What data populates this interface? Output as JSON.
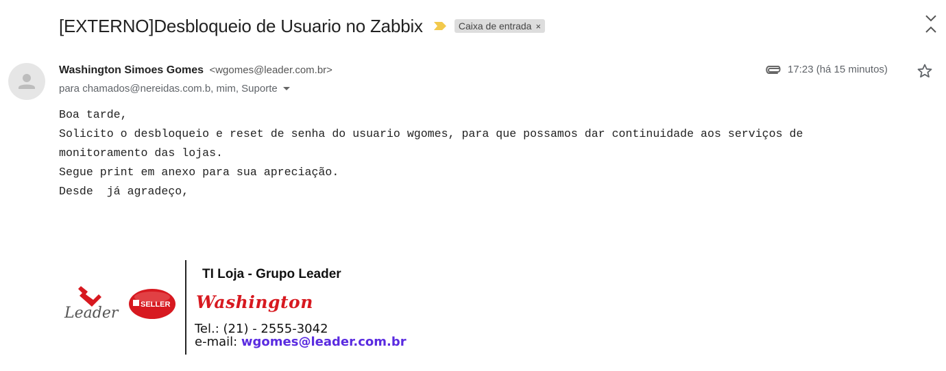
{
  "email": {
    "subject": "[EXTERNO]Desbloqueio de Usuario no Zabbix",
    "label": "Caixa de entrada",
    "label_close": "×",
    "sender_name": "Washington Simoes Gomes",
    "sender_email": "<wgomes@leader.com.br>",
    "recipients": "para chamados@nereidas.com.b, mim, Suporte",
    "time": "17:23 (há 15 minutos)",
    "body_lines": [
      "Boa tarde,",
      "Solicito o desbloqueio e reset de senha do usuario wgomes, para que possamos dar continuidade aos serviços de",
      "monitoramento das lojas.",
      "Segue print em anexo para sua apreciação.",
      "",
      "Desde  já agradeço,"
    ]
  },
  "signature": {
    "title": "TI Loja - Grupo Leader",
    "name": "Washington",
    "tel": "Tel.: (21) - 2555-3042",
    "email_label": "e-mail: ",
    "email_address": "wgomes@leader.com.br",
    "leader_logo_text": "Leader",
    "seller_logo_text": "SELLER"
  },
  "icons": {
    "importance": "importance-marker-icon",
    "expand": "expand-collapse-icon",
    "attachment": "paperclip-icon",
    "star": "star-icon",
    "avatar": "person-icon"
  },
  "colors": {
    "importance": "#f2c94c",
    "brand_red": "#d71920",
    "email_link": "#5a2be0"
  }
}
